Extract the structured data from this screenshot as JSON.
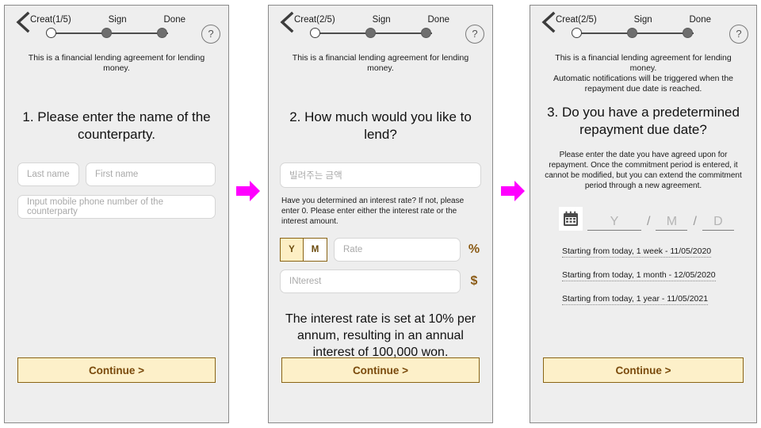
{
  "common": {
    "back_icon": "chevron-left-icon",
    "help_label": "?",
    "steps": [
      "Sign",
      "Done"
    ],
    "continue_label": "Continue >",
    "arrow_color": "#ff00ff"
  },
  "screen1": {
    "step_current": "Creat(1/5)",
    "step_sign": "Sign",
    "step_done": "Done",
    "notice": "This is a financial lending agreement for lending money.",
    "question": "1. Please enter the name of the counterparty.",
    "last_name_placeholder": "Last name",
    "first_name_placeholder": "First name",
    "phone_placeholder": "Input mobile phone number of the counterparty",
    "continue_label": "Continue >"
  },
  "screen2": {
    "step_current": "Creat(2/5)",
    "step_sign": "Sign",
    "step_done": "Done",
    "notice": "This is a financial lending agreement for lending money.",
    "question": "2. How much would you like to lend?",
    "amount_placeholder": "빌려주는 금액",
    "helper": "Have you determined an interest rate? If not, please enter 0. Please enter either the interest rate or the interest amount.",
    "toggle_year": "Y",
    "toggle_month": "M",
    "toggle_selected": "Y",
    "rate_placeholder": "Rate",
    "rate_unit": "%",
    "interest_placeholder": "INterest",
    "interest_unit": "$",
    "summary": "The interest rate is set at 10% per annum, resulting in an annual interest of 100,000 won.",
    "continue_label": "Continue >"
  },
  "screen3": {
    "step_current": "Creat(2/5)",
    "step_sign": "Sign",
    "step_done": "Done",
    "notice": "This is a financial lending agreement for lending money.\nAutomatic notifications will be triggered when the repayment due date is reached.",
    "question": "3. Do you have a predetermined repayment due date?",
    "helper": "Please enter the date you have agreed upon for repayment. Once the commitment period is entered, it cannot be modified, but you can extend the commitment period through a new agreement.",
    "calendar_icon": "calendar-icon",
    "date_year_placeholder": "Y",
    "date_month_placeholder": "M",
    "date_day_placeholder": "D",
    "date_separator": "/",
    "presets": [
      "Starting from today, 1 week - 11/05/2020",
      "Starting from today, 1 month - 12/05/2020",
      "Starting from today, 1 year - 11/05/2021"
    ],
    "continue_label": "Continue >"
  }
}
